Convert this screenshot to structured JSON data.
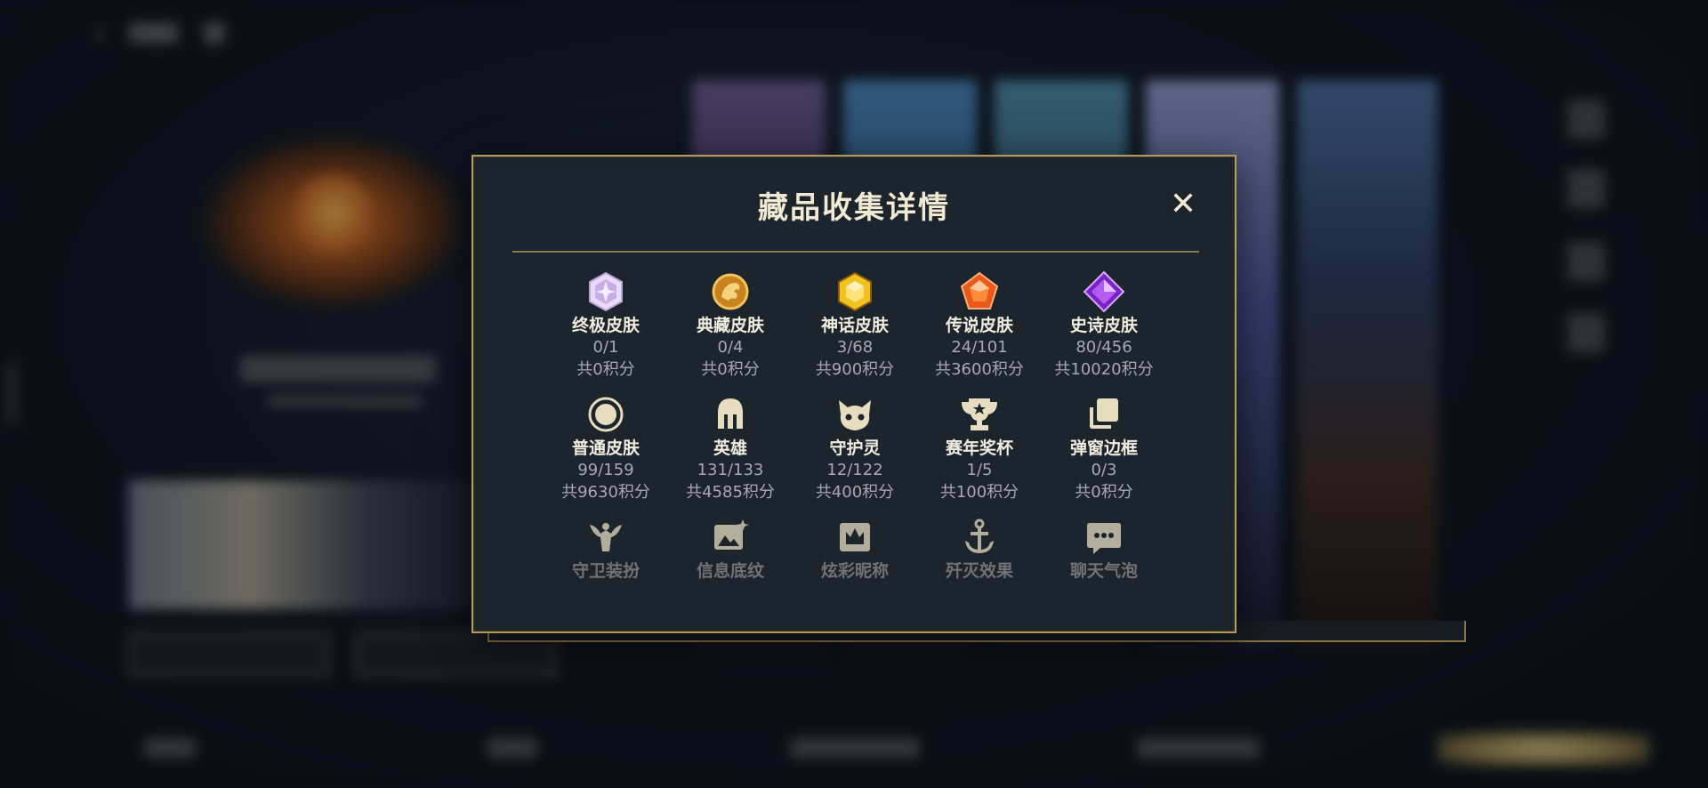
{
  "modal": {
    "title": "藏品收集详情",
    "close_glyph": "✕"
  },
  "categories": [
    {
      "label": "终极皮肤",
      "count": "0/1",
      "points": "共0积分",
      "icon": "ultimate-skin-icon",
      "color": "#c9b6ea"
    },
    {
      "label": "典藏皮肤",
      "count": "0/4",
      "points": "共0积分",
      "icon": "prestige-skin-icon",
      "color": "#e0a43a"
    },
    {
      "label": "神话皮肤",
      "count": "3/68",
      "points": "共900积分",
      "icon": "mythic-skin-icon",
      "color": "#e8b21f"
    },
    {
      "label": "传说皮肤",
      "count": "24/101",
      "points": "共3600积分",
      "icon": "legendary-skin-icon",
      "color": "#e05a1c"
    },
    {
      "label": "史诗皮肤",
      "count": "80/456",
      "points": "共10020积分",
      "icon": "epic-skin-icon",
      "color": "#9a39d8"
    },
    {
      "label": "普通皮肤",
      "count": "99/159",
      "points": "共9630积分",
      "icon": "normal-skin-icon",
      "color": "#e6dcc0"
    },
    {
      "label": "英雄",
      "count": "131/133",
      "points": "共4585积分",
      "icon": "hero-helmet-icon",
      "color": "#e6dcc0"
    },
    {
      "label": "守护灵",
      "count": "12/122",
      "points": "共400积分",
      "icon": "guardian-spirit-icon",
      "color": "#e6dcc0"
    },
    {
      "label": "赛年奖杯",
      "count": "1/5",
      "points": "共100积分",
      "icon": "season-trophy-icon",
      "color": "#e6dcc0"
    },
    {
      "label": "弹窗边框",
      "count": "0/3",
      "points": "共0积分",
      "icon": "popup-frame-icon",
      "color": "#e6dcc0"
    },
    {
      "label": "守卫装扮",
      "icon": "ward-skin-icon",
      "color": "#e6dcc0"
    },
    {
      "label": "信息底纹",
      "icon": "info-banner-icon",
      "color": "#e6dcc0"
    },
    {
      "label": "炫彩昵称",
      "icon": "colorful-nickname-icon",
      "color": "#e6dcc0"
    },
    {
      "label": "歼灭效果",
      "icon": "ace-effect-icon",
      "color": "#e6dcc0"
    },
    {
      "label": "聊天气泡",
      "icon": "chat-bubble-icon",
      "color": "#e6dcc0"
    }
  ],
  "theme": {
    "modal_bg": "#1c242c",
    "gold_border": "#b49a5e",
    "title_color": "#f1e9d2",
    "muted_text": "#a4aab0"
  }
}
